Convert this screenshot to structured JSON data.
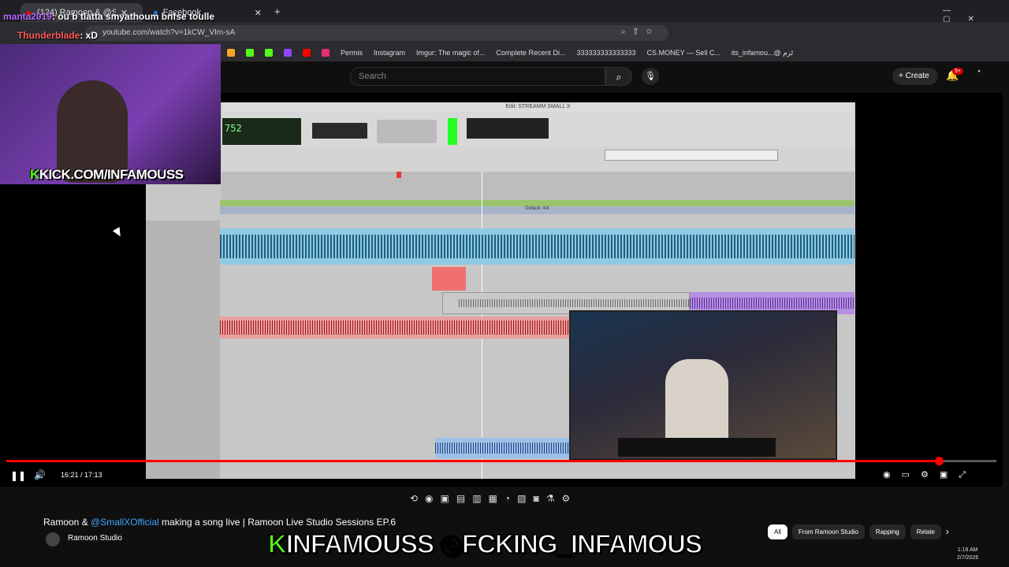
{
  "browser": {
    "tabs": [
      {
        "label": "(124) Ramoon & @SmallXO"
      },
      {
        "label": "Facebook"
      }
    ],
    "url": "youtube.com/watch?v=1kCW_VIm-sA",
    "bookmarks": [
      "Permis",
      "Instagram",
      "Imgur: The magic of...",
      "Complete Recent Di...",
      "333333333333333",
      "CS.MONEY — Sell C...",
      "its_infamou...@ ٹرم"
    ]
  },
  "youtube": {
    "search_placeholder": "Search",
    "create_label": "Create",
    "notification_count": "9+",
    "video_title_prefix": "Ramoon & ",
    "video_title_mention": "@SmallXOfficial",
    "video_title_rest": " making a song live | Ramoon Live Studio Sessions EP.6",
    "channel_name": "Ramoon Studio",
    "time_display": "16:21 / 17:13",
    "progress": 0.942,
    "chips": [
      "All",
      "From Ramoon Studio",
      "Rapping",
      "Relate"
    ]
  },
  "overlay": {
    "chat": [
      {
        "user": "manta2019",
        "message": ": ou b tlatta smyathoum bnfse toulle"
      },
      {
        "user": "Thunderblade",
        "message": ": xD"
      }
    ],
    "kick_handle": "KICK.COM/INFAMOUSS",
    "banner_left": "INFAMOUSS",
    "banner_right": "FCKING_INFAMOUS"
  },
  "daw": {
    "window_title": "Edit: STREAMM SMALL X",
    "counter": "752",
    "meter_label": "Default: 4/4"
  },
  "taskbar": {
    "time": "1:18 AM",
    "date": "2/7/2026"
  },
  "colors": {
    "accent_red": "#ff0000",
    "kick_green": "#53fc18",
    "mention_blue": "#3ea6ff"
  }
}
